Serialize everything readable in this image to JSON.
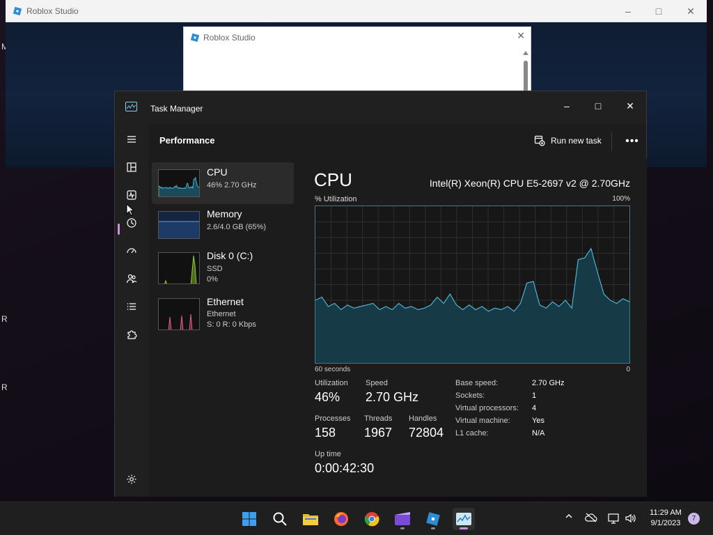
{
  "desktop": {
    "side_letters": [
      "M",
      "R",
      "R"
    ]
  },
  "roblox": {
    "window_title": "Roblox Studio",
    "dialog_title": "Roblox Studio"
  },
  "task_manager": {
    "title": "Task Manager",
    "page_title": "Performance",
    "run_new_task": "Run new task",
    "more": "•••",
    "resources": [
      {
        "name": "CPU",
        "lines": [
          "46%  2.70 GHz"
        ]
      },
      {
        "name": "Memory",
        "lines": [
          "2.6/4.0 GB (65%)"
        ]
      },
      {
        "name": "Disk 0 (C:)",
        "lines": [
          "SSD",
          "0%"
        ]
      },
      {
        "name": "Ethernet",
        "lines": [
          "Ethernet",
          "S: 0  R: 0 Kbps"
        ]
      }
    ],
    "main": {
      "title": "CPU",
      "model": "Intel(R) Xeon(R) CPU E5-2697 v2 @ 2.70GHz",
      "util_label": "% Utilization",
      "util_max": "100%",
      "axis_left": "60 seconds",
      "axis_right": "0",
      "utilization_label": "Utilization",
      "utilization_value": "46%",
      "speed_label": "Speed",
      "speed_value": "2.70 GHz",
      "processes_label": "Processes",
      "processes_value": "158",
      "threads_label": "Threads",
      "threads_value": "1967",
      "handles_label": "Handles",
      "handles_value": "72804",
      "uptime_label": "Up time",
      "uptime_value": "0:00:42:30",
      "specs": [
        {
          "k": "Base speed:",
          "v": "2.70 GHz"
        },
        {
          "k": "Sockets:",
          "v": "1"
        },
        {
          "k": "Virtual processors:",
          "v": "4"
        },
        {
          "k": "Virtual machine:",
          "v": "Yes"
        },
        {
          "k": "L1 cache:",
          "v": "N/A"
        }
      ]
    },
    "cpu_history": [
      40,
      42,
      36,
      38,
      34,
      37,
      35,
      36,
      37,
      38,
      34,
      36,
      34,
      38,
      35,
      36,
      34,
      35,
      37,
      42,
      38,
      44,
      37,
      34,
      37,
      34,
      36,
      33,
      35,
      34,
      36,
      33,
      38,
      51,
      52,
      37,
      35,
      39,
      36,
      40,
      35,
      66,
      67,
      73,
      58,
      44,
      40,
      38,
      41,
      39
    ]
  },
  "taskbar": {
    "time": "11:29 AM",
    "date": "9/1/2023",
    "notification_count": "7",
    "tray_up": "^"
  },
  "colors": {
    "accent": "#d08ce0",
    "cpu_line": "#4fb3d0",
    "memory_line": "#6a9fd8",
    "disk_line": "#93c43a",
    "ethernet_line": "#e0608a"
  }
}
